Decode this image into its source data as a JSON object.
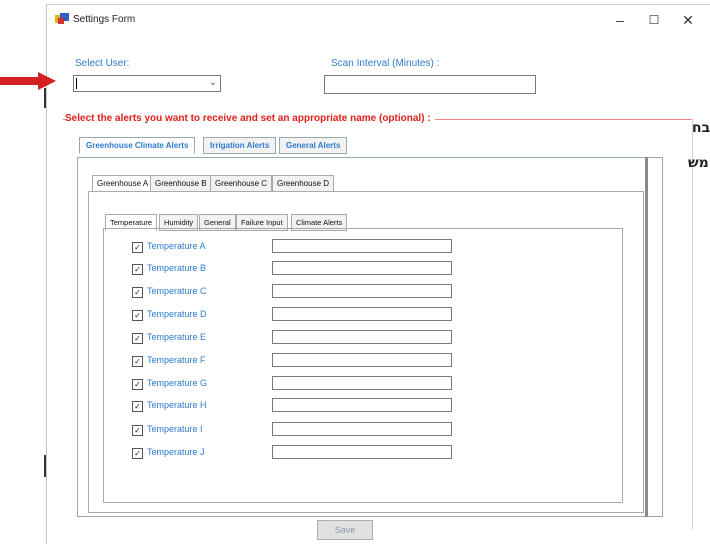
{
  "window": {
    "title": "Settings Form",
    "minimize": "–",
    "maximize": "☐",
    "close": "✕"
  },
  "top": {
    "select_user_label": "Select User:",
    "scan_interval_label": "Scan Interval (Minutes) :",
    "select_user_value": "",
    "scan_interval_value": ""
  },
  "alerts_group_label": "Select the alerts you want to receive and set an appropriate name (optional)  :",
  "main_tabs": [
    "Greenhouse Climate Alerts",
    "Irrigation Alerts",
    "General Alerts"
  ],
  "greenhouse_tabs": [
    "Greenhouse A",
    "Greenhouse B",
    "Greenhouse C",
    "Greenhouse D"
  ],
  "category_tabs": [
    "Temperature",
    "Humidity",
    "General",
    "Failure Input",
    "Climate Alerts"
  ],
  "rows": [
    {
      "label": "Temperature A",
      "checked": true,
      "value": ""
    },
    {
      "label": "Temperature B",
      "checked": true,
      "value": ""
    },
    {
      "label": "Temperature C",
      "checked": true,
      "value": ""
    },
    {
      "label": "Temperature D",
      "checked": true,
      "value": ""
    },
    {
      "label": "Temperature E",
      "checked": true,
      "value": ""
    },
    {
      "label": "Temperature F",
      "checked": true,
      "value": ""
    },
    {
      "label": "Temperature G",
      "checked": true,
      "value": ""
    },
    {
      "label": "Temperature H",
      "checked": true,
      "value": ""
    },
    {
      "label": "Temperature I",
      "checked": true,
      "value": ""
    },
    {
      "label": "Temperature J",
      "checked": true,
      "value": ""
    }
  ],
  "save_label": "Save",
  "side_text": {
    "line1": "בח",
    "line2": "מש"
  },
  "colors": {
    "label_blue": "#2e7bcf",
    "label_red": "#e0201a",
    "arrow_red": "#d42020"
  }
}
